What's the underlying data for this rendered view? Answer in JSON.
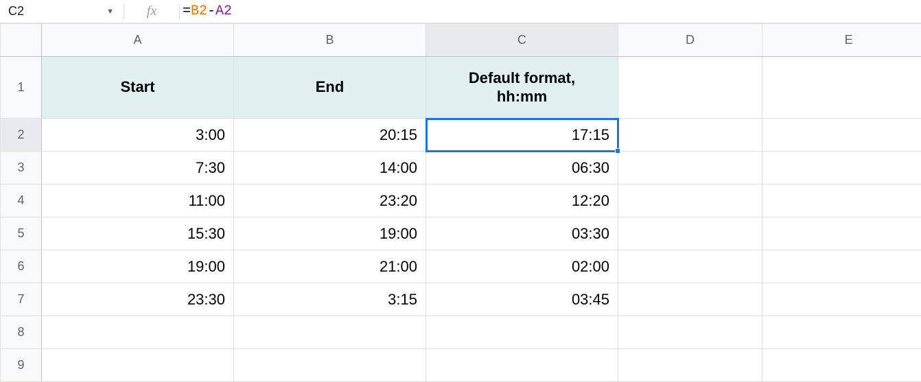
{
  "nameBox": "C2",
  "formula": {
    "eq": "=",
    "ref1": "B2",
    "op": "-",
    "ref2": "A2"
  },
  "columns": [
    "A",
    "B",
    "C",
    "D",
    "E"
  ],
  "rowNumbers": [
    1,
    2,
    3,
    4,
    5,
    6,
    7,
    8,
    9
  ],
  "activeCell": {
    "row": 2,
    "col": "C"
  },
  "headers": {
    "A": "Start",
    "B": "End",
    "C": "Default format,\nhh:mm"
  },
  "rows": [
    {
      "A": "3:00",
      "B": "20:15",
      "C": "17:15"
    },
    {
      "A": "7:30",
      "B": "14:00",
      "C": "06:30"
    },
    {
      "A": "11:00",
      "B": "23:20",
      "C": "12:20"
    },
    {
      "A": "15:30",
      "B": "19:00",
      "C": "03:30"
    },
    {
      "A": "19:00",
      "B": "21:00",
      "C": "02:00"
    },
    {
      "A": "23:30",
      "B": "3:15",
      "C": "03:45"
    }
  ],
  "chart_data": {
    "type": "table",
    "title": "",
    "columns": [
      "Start",
      "End",
      "Default format, hh:mm"
    ],
    "rows": [
      [
        "3:00",
        "20:15",
        "17:15"
      ],
      [
        "7:30",
        "14:00",
        "06:30"
      ],
      [
        "11:00",
        "23:20",
        "12:20"
      ],
      [
        "15:30",
        "19:00",
        "03:30"
      ],
      [
        "19:00",
        "21:00",
        "02:00"
      ],
      [
        "23:30",
        "3:15",
        "03:45"
      ]
    ]
  }
}
